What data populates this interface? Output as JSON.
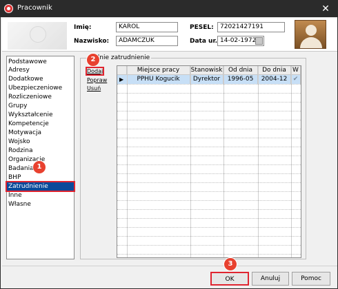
{
  "window": {
    "title": "Pracownik",
    "close_glyph": "✕"
  },
  "header": {
    "first_name_label": "Imię:",
    "first_name_value": "KAROL",
    "last_name_label": "Nazwisko:",
    "last_name_value": "ADAMCZUK",
    "pesel_label": "PESEL:",
    "pesel_value": "72021427191",
    "birth_label": "Data ur.:",
    "birth_value": "14-02-1972"
  },
  "sidebar": {
    "items": [
      {
        "label": "Podstawowe"
      },
      {
        "label": "Adresy"
      },
      {
        "label": "Dodatkowe"
      },
      {
        "label": "Ubezpieczeniowe"
      },
      {
        "label": "Rozliczeniowe"
      },
      {
        "label": "Grupy"
      },
      {
        "label": "Wykształcenie"
      },
      {
        "label": "Kompetencje"
      },
      {
        "label": "Motywacja"
      },
      {
        "label": "Wojsko"
      },
      {
        "label": "Rodzina"
      },
      {
        "label": "Organizacje"
      },
      {
        "label": "Badania"
      },
      {
        "label": "BHP"
      },
      {
        "label": "Zatrudnienie"
      },
      {
        "label": "Inne"
      },
      {
        "label": "Własne"
      }
    ],
    "selected": "Zatrudnienie"
  },
  "section": {
    "legend": "ednie zatrudnienie",
    "actions": {
      "add": "Dodaj",
      "edit": "Popraw",
      "delete": "Usuń"
    }
  },
  "grid": {
    "columns": [
      "Miejsce pracy",
      "Stanowisk",
      "Od dnia",
      "Do dnia",
      "W"
    ],
    "rows": [
      {
        "indicator": "▶",
        "place": "PPHU Kogucik",
        "position": "Dyrektor",
        "from": "1996-05",
        "to": "2004-12",
        "w": "✔"
      }
    ]
  },
  "buttons": {
    "ok": "OK",
    "cancel": "Anuluj",
    "help": "Pomoc"
  },
  "badges": {
    "b1": "1",
    "b2": "2",
    "b3": "3"
  },
  "colors": {
    "highlight": "#e0242f",
    "badge": "#e8412f",
    "selection": "#0a4a9a"
  }
}
